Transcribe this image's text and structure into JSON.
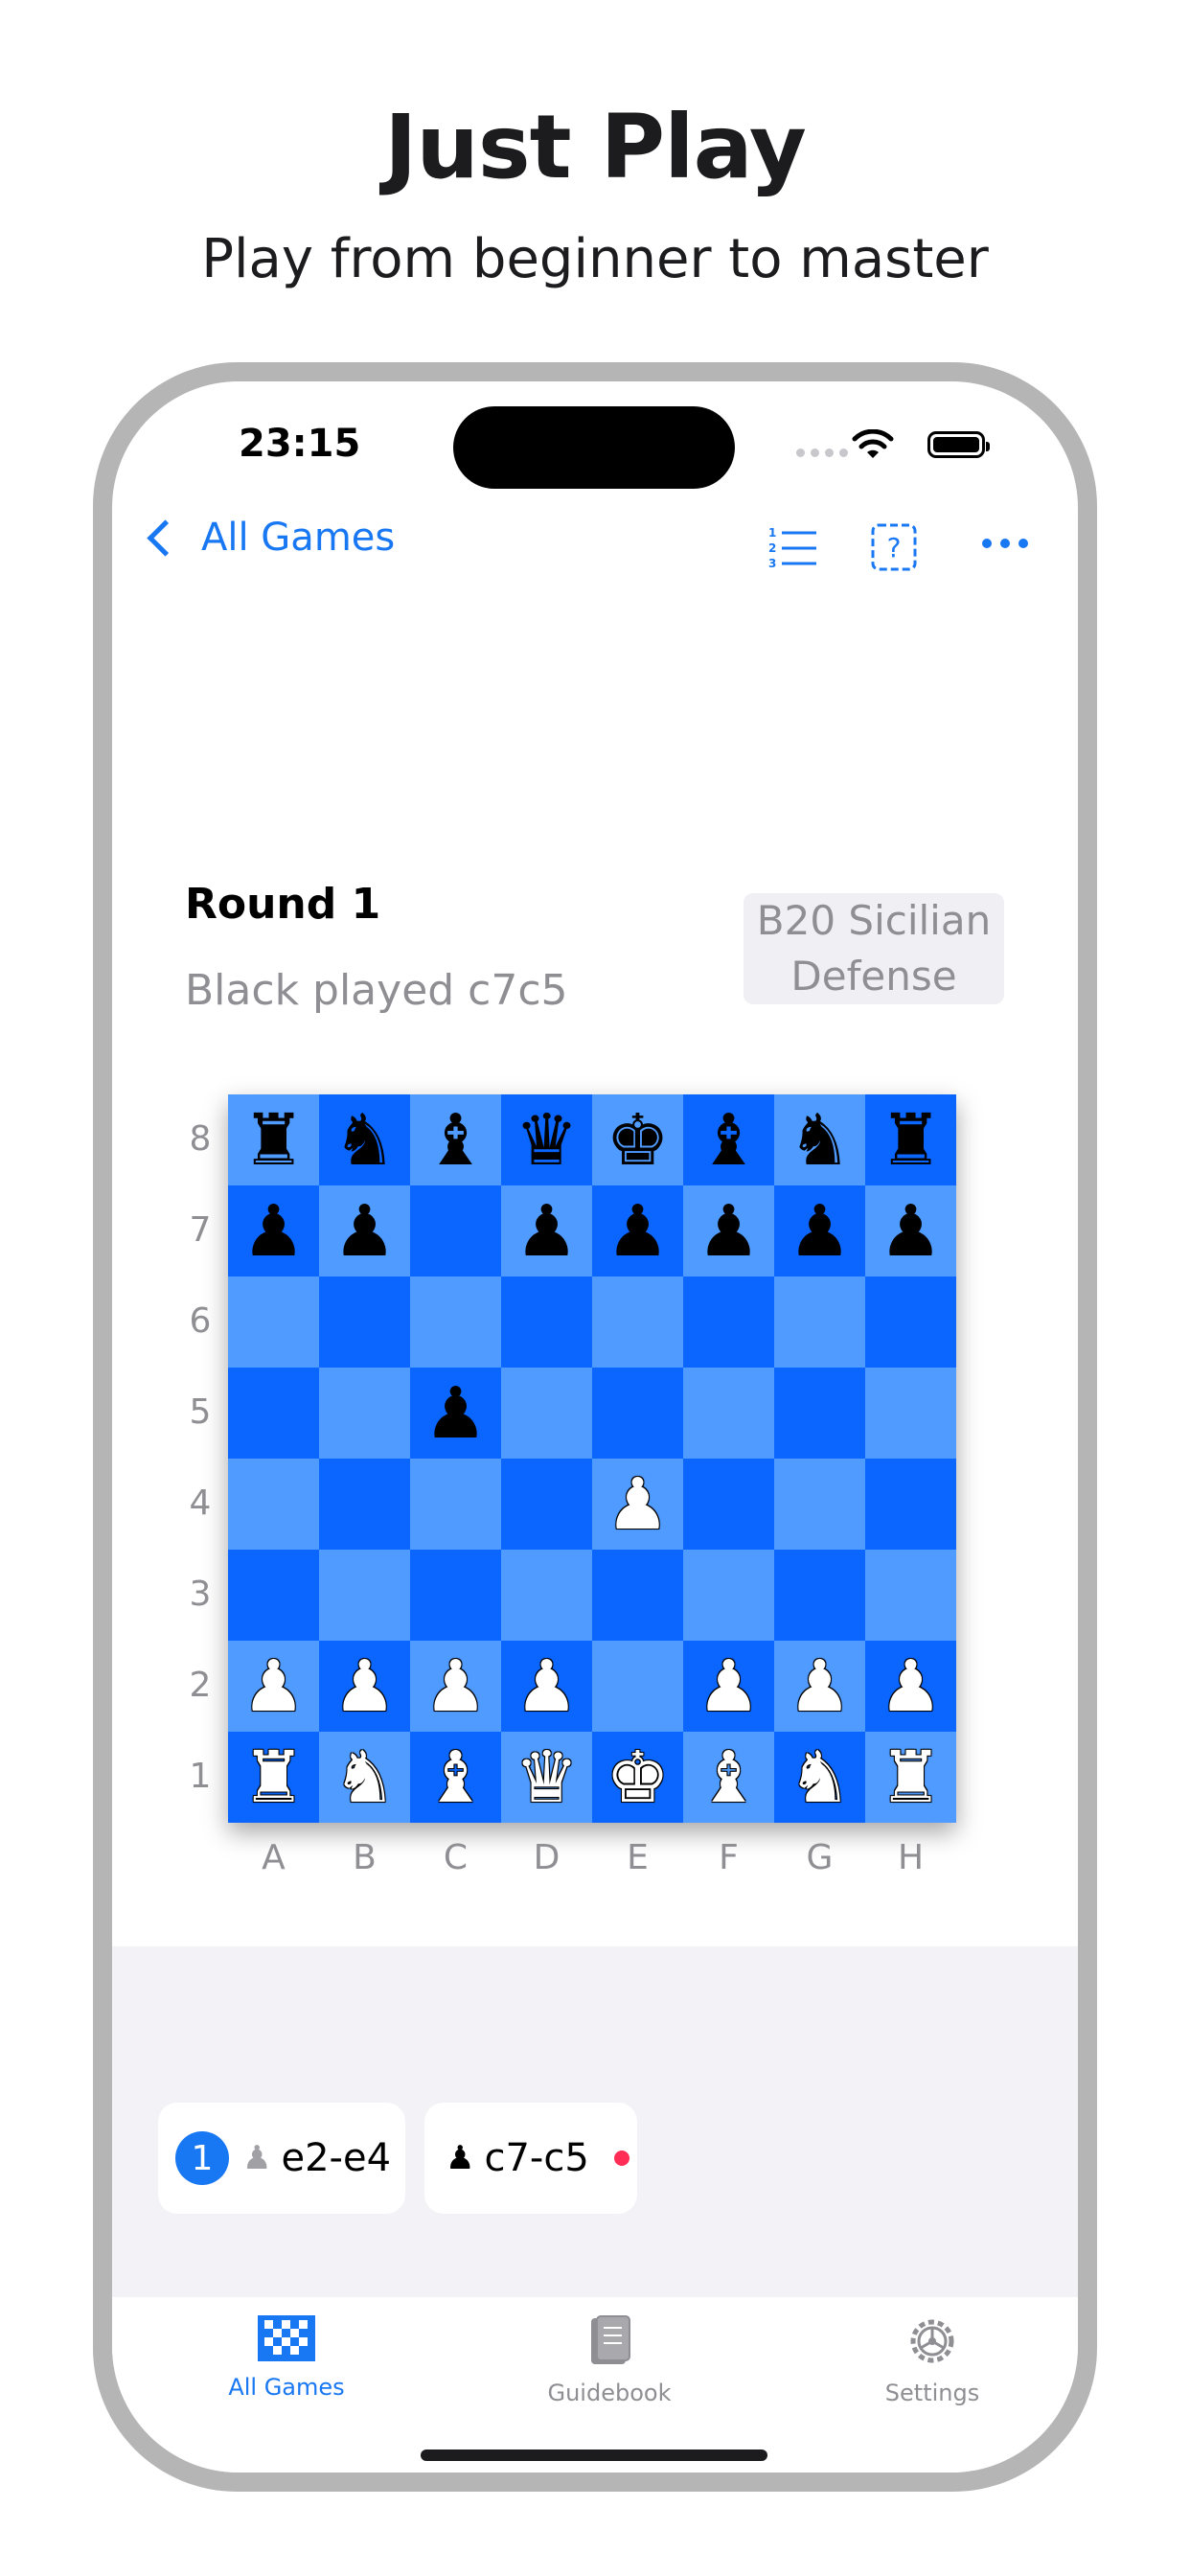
{
  "marketing": {
    "headline": "Just Play",
    "subheadline": "Play from beginner to master"
  },
  "status_bar": {
    "time": "23:15"
  },
  "nav": {
    "back_label": "All Games",
    "icons": [
      "numbered-list-icon",
      "help-icon",
      "more-icon"
    ]
  },
  "game": {
    "round_title": "Round 1",
    "last_move_text": "Black played c7c5",
    "opening_line1": "B20 Sicilian",
    "opening_line2": "Defense"
  },
  "board": {
    "files": [
      "A",
      "B",
      "C",
      "D",
      "E",
      "F",
      "G",
      "H"
    ],
    "ranks": [
      "8",
      "7",
      "6",
      "5",
      "4",
      "3",
      "2",
      "1"
    ],
    "position": [
      [
        "bR",
        "bN",
        "bB",
        "bQ",
        "bK",
        "bB",
        "bN",
        "bR"
      ],
      [
        "bP",
        "bP",
        "",
        "bP",
        "bP",
        "bP",
        "bP",
        "bP"
      ],
      [
        "",
        "",
        "",
        "",
        "",
        "",
        "",
        ""
      ],
      [
        "",
        "",
        "bP",
        "",
        "",
        "",
        "",
        ""
      ],
      [
        "",
        "",
        "",
        "",
        "wP",
        "",
        "",
        ""
      ],
      [
        "",
        "",
        "",
        "",
        "",
        "",
        "",
        ""
      ],
      [
        "wP",
        "wP",
        "wP",
        "wP",
        "",
        "wP",
        "wP",
        "wP"
      ],
      [
        "wR",
        "wN",
        "wB",
        "wQ",
        "wK",
        "wB",
        "wN",
        "wR"
      ]
    ],
    "colors": {
      "light": "#4f9bff",
      "dark": "#0a66ff"
    }
  },
  "moves": {
    "move_number": "1",
    "white_move": "e2-e4",
    "black_move": "c7-c5"
  },
  "tabbar": {
    "tabs": [
      {
        "label": "All Games",
        "icon": "checkerboard-icon",
        "active": true
      },
      {
        "label": "Guidebook",
        "icon": "book-icon",
        "active": false
      },
      {
        "label": "Settings",
        "icon": "gear-icon",
        "active": false
      }
    ]
  },
  "accent_color": "#1877f2"
}
